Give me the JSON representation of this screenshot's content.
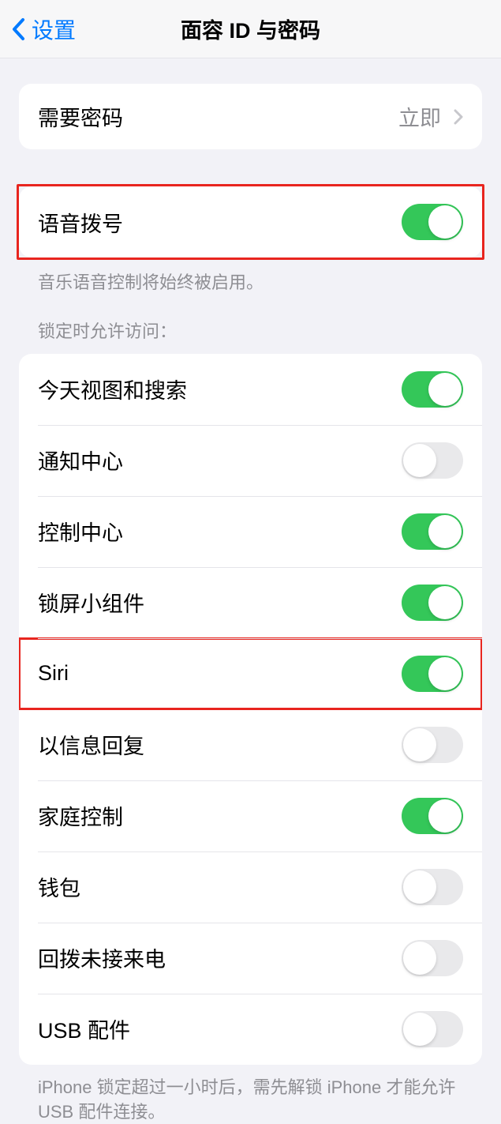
{
  "header": {
    "back_label": "设置",
    "title": "面容 ID 与密码"
  },
  "require_passcode": {
    "label": "需要密码",
    "value": "立即"
  },
  "voice_dial": {
    "label": "语音拨号",
    "on": true,
    "footer": "音乐语音控制将始终被启用。"
  },
  "lock_access": {
    "header": "锁定时允许访问：",
    "items": [
      {
        "label": "今天视图和搜索",
        "on": true
      },
      {
        "label": "通知中心",
        "on": false
      },
      {
        "label": "控制中心",
        "on": true
      },
      {
        "label": "锁屏小组件",
        "on": true
      },
      {
        "label": "Siri",
        "on": true
      },
      {
        "label": "以信息回复",
        "on": false
      },
      {
        "label": "家庭控制",
        "on": true
      },
      {
        "label": "钱包",
        "on": false
      },
      {
        "label": "回拨未接来电",
        "on": false
      },
      {
        "label": "USB 配件",
        "on": false
      }
    ],
    "footer": "iPhone 锁定超过一小时后，需先解锁 iPhone 才能允许USB 配件连接。"
  }
}
